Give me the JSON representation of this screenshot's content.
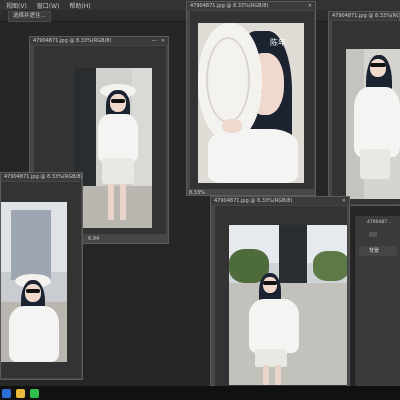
{
  "menubar": {
    "items": [
      "视图(V)",
      "窗口(W)",
      "帮助(H)"
    ]
  },
  "options_bar": {
    "chip_label": "选择并遮住..."
  },
  "windows": [
    {
      "title": "47904871.jpg @ 8.33%(RGB/8)",
      "zoom": "6.94"
    },
    {
      "title": "47904871.jpg @ 8.33%(RGB/8)",
      "zoom": "8.33%"
    },
    {
      "title": "47904871.jpg @ 8.33%(RGB/8)",
      "zoom": ""
    },
    {
      "title": "47904871.jpg @ 8.33%(RGB/8)",
      "zoom": ""
    },
    {
      "title": "47904871.jpg @ 8.33%(RGB/8)",
      "zoom": ""
    }
  ],
  "window_controls": {
    "minimize": "—",
    "maximize": "□",
    "close": "✕"
  },
  "watermark_text": "陈年",
  "layers_panel": {
    "title": "4790487...",
    "row_label": "背景"
  },
  "taskbar": {
    "icons": [
      {
        "name": "photoshop-icon",
        "color": "#2e6fd8"
      },
      {
        "name": "folder-icon",
        "color": "#e8b93a"
      },
      {
        "name": "wechat-icon",
        "color": "#2fbf4f"
      }
    ]
  },
  "colors": {
    "workspace": "#262626",
    "panel": "#3b3b3b",
    "accent": "#2e6fd8"
  }
}
